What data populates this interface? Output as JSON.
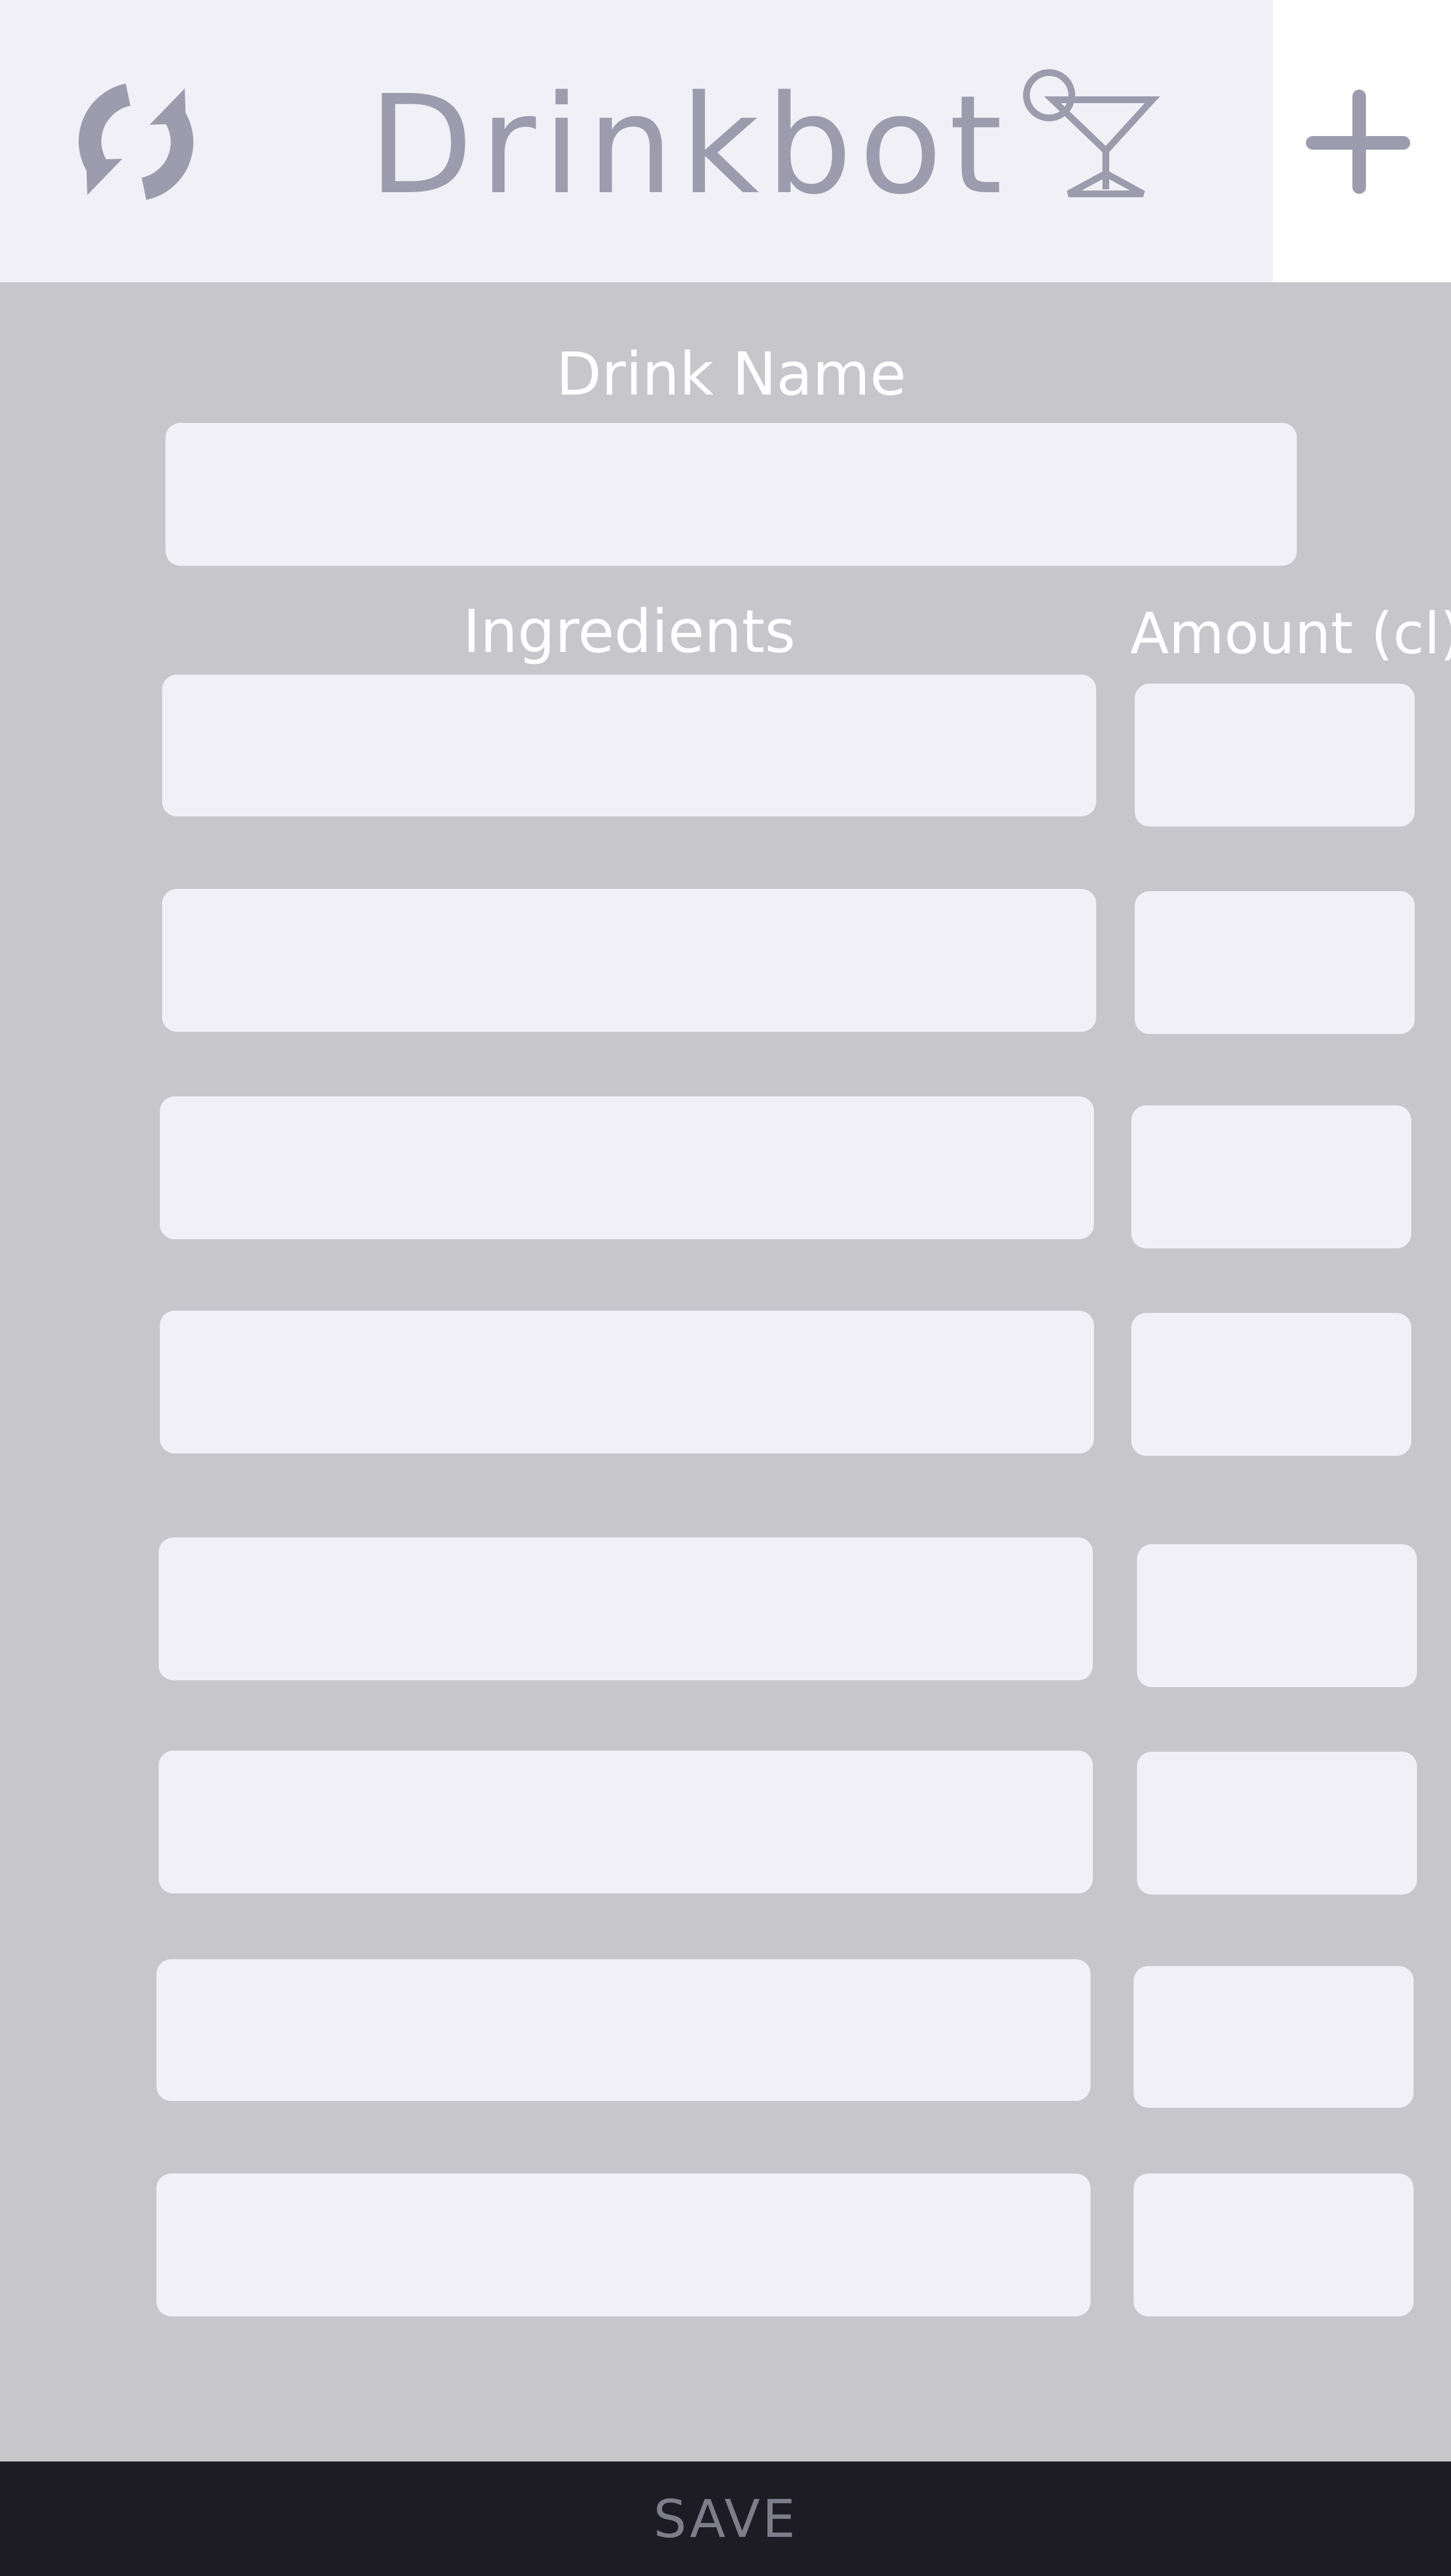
{
  "app": {
    "title": "Drinkbot"
  },
  "header": {
    "refresh_icon": "refresh-icon",
    "logo_icon": "cocktail-glass-icon",
    "add_icon": "plus-icon"
  },
  "form": {
    "drink_name_label": "Drink Name",
    "drink_name_value": "",
    "ingredients_label": "Ingredients",
    "amount_label": "Amount (cl)",
    "rows": [
      {
        "ingredient": "",
        "amount": ""
      },
      {
        "ingredient": "",
        "amount": ""
      },
      {
        "ingredient": "",
        "amount": ""
      },
      {
        "ingredient": "",
        "amount": ""
      },
      {
        "ingredient": "",
        "amount": ""
      },
      {
        "ingredient": "",
        "amount": ""
      },
      {
        "ingredient": "",
        "amount": ""
      },
      {
        "ingredient": "",
        "amount": ""
      }
    ]
  },
  "footer": {
    "save_label": "SAVE"
  },
  "colors": {
    "header_bg": "#f0f0f6",
    "form_bg": "#c7c6cb",
    "field_bg": "#f0f0f6",
    "accent": "#9d9cae",
    "footer_bg": "#1d1c24",
    "footer_text": "#7e7d8b",
    "label_text": "#ffffff"
  }
}
